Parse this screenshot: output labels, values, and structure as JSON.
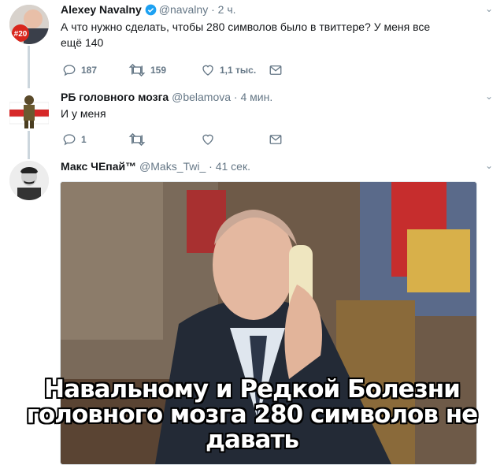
{
  "tweets": [
    {
      "name": "Alexey Navalny",
      "handle": "@navalny",
      "time": "· 2 ч.",
      "text_lines": [
        "А что нужно сделать, чтобы 280 символов было в твиттере? У меня все",
        "ещё 140"
      ],
      "replies": "187",
      "retweets": "159",
      "likes": "1,1 тыс.",
      "avatar_badge": "#20"
    },
    {
      "name": "РБ головного мозга",
      "handle": "@belamova",
      "time": "· 4 мин.",
      "text_lines": [
        "И у меня"
      ],
      "replies": "1",
      "retweets": "",
      "likes": ""
    },
    {
      "name": "Макс ЧЕпай™",
      "handle": "@Maks_Twi_",
      "time": "· 41 сек."
    }
  ],
  "meme": {
    "lines": [
      "Навальному и Редкой Болезни",
      "головного мозга 280 символов не",
      "давать"
    ]
  },
  "colors": {
    "verified": "#1da1f2",
    "icon": "#657786",
    "line": "#ccd6dd"
  }
}
